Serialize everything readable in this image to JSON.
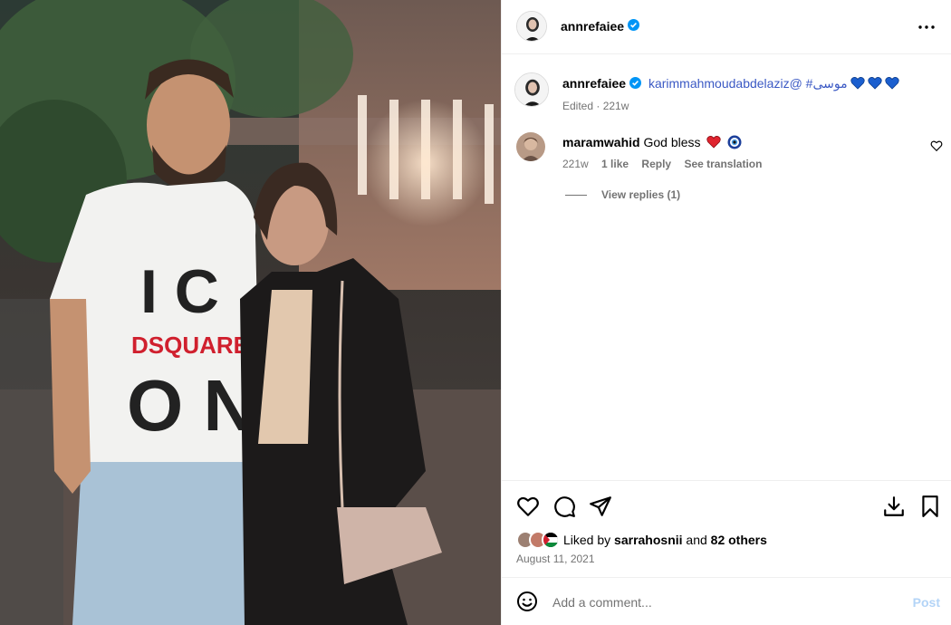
{
  "post": {
    "username": "annrefaiee",
    "verified": true,
    "photo_alt": "couple photo"
  },
  "caption": {
    "username": "annrefaiee",
    "mention": "karimmahmoudabdelaziz@",
    "hashtag": "#موسى",
    "emojis": [
      "blue-heart",
      "blue-heart",
      "blue-heart"
    ],
    "meta": "Edited · 221w"
  },
  "comments": [
    {
      "username": "maramwahid",
      "text": "God bless",
      "emojis": [
        "red-heart",
        "nazar-amulet"
      ],
      "age": "221w",
      "likes": "1 like",
      "reply_label": "Reply",
      "translate_label": "See translation",
      "view_replies": "View replies (1)"
    }
  ],
  "likes": {
    "prefix": "Liked by",
    "user": "sarrahosnii",
    "and": "and",
    "others": "82 others"
  },
  "date": "August 11, 2021",
  "add_comment": {
    "placeholder": "Add a comment...",
    "post_label": "Post"
  },
  "colors": {
    "link": "#3b59c4",
    "verified": "#0095f6",
    "muted": "#737373",
    "post_disabled": "#b3d4f7",
    "divider": "#efefef"
  }
}
